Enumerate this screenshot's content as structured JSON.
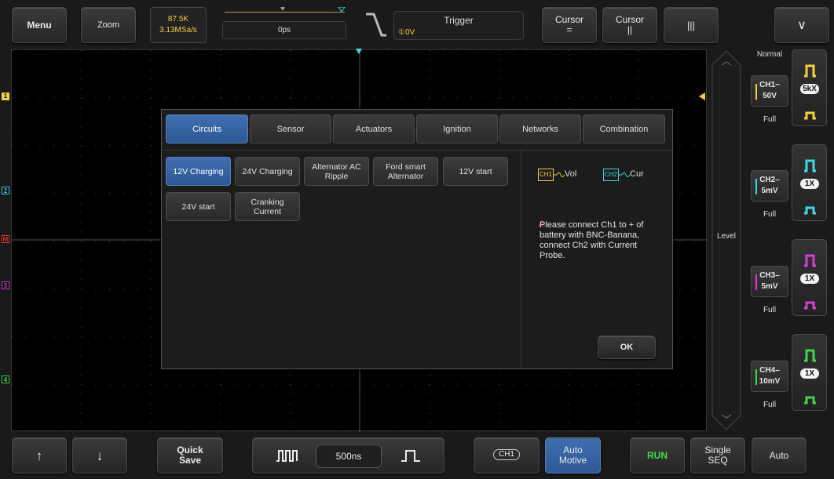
{
  "top": {
    "menu_label": "Menu",
    "zoom_label": "Zoom",
    "record_length": "87.5K",
    "sample_rate": "3.13MSa/s",
    "trigger_position": "0ps",
    "trigger_title": "Trigger",
    "trigger_level": "①0V",
    "cursor_h_label": "Cursor",
    "cursor_h_symbol": "=",
    "cursor_v_label": "Cursor",
    "cursor_v_symbol": "||",
    "measure_symbol": "|||",
    "collapse_symbol": "∨"
  },
  "right": {
    "level_label": "Level",
    "mode_label": "Normal",
    "channels": [
      {
        "name": "CH1",
        "coupling": "~",
        "scale": "50V",
        "bw": "Full",
        "probe": "5kX",
        "color": "#f4d03f"
      },
      {
        "name": "CH2",
        "coupling": "–",
        "scale": "5mV",
        "bw": "Full",
        "probe": "1X",
        "color": "#3fd7e0"
      },
      {
        "name": "CH3",
        "coupling": "–",
        "scale": "5mV",
        "bw": "Full",
        "probe": "1X",
        "color": "#d63fd6"
      },
      {
        "name": "CH4",
        "coupling": "–",
        "scale": "10mV",
        "bw": "Full",
        "probe": "1X",
        "color": "#3fd74a"
      }
    ]
  },
  "grid_markers": [
    "1",
    "2",
    "M",
    "3",
    "4"
  ],
  "dialog": {
    "tabs": [
      "Circuits",
      "Sensor",
      "Actuators",
      "Ignition",
      "Networks",
      "Combination"
    ],
    "active_tab": "Circuits",
    "items": [
      "12V Charging",
      "24V Charging",
      "Alternator AC Ripple",
      "Ford smart Alternator",
      "12V start",
      "24V start",
      "Cranking Current"
    ],
    "active_item": "12V Charging",
    "probe1_tag": "CH1",
    "probe1_label": "Vol",
    "probe2_tag": "CH2",
    "probe2_label": "Cur",
    "warning_symbol": "⚠",
    "message": "Please connect Ch1 to + of battery with BNC-Banana, connect Ch2 with Current Probe.",
    "ok_label": "OK"
  },
  "bottom": {
    "up_symbol": "↑",
    "down_symbol": "↓",
    "quick_save_1": "Quick",
    "quick_save_2": "Save",
    "time_div": "500ns",
    "source_channel": "CH1",
    "auto_motive_1": "Auto",
    "auto_motive_2": "Motive",
    "run_label": "RUN",
    "single_1": "Single",
    "single_2": "SEQ",
    "auto_label": "Auto"
  }
}
